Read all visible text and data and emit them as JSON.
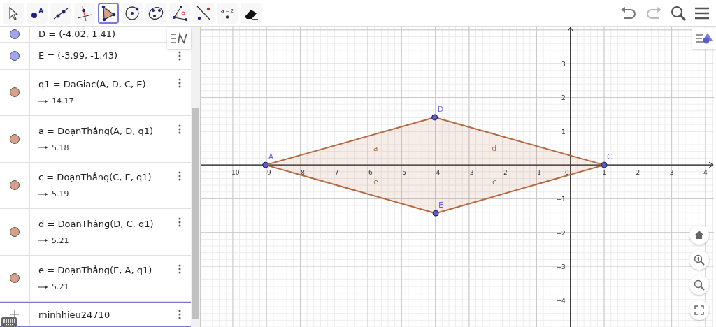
{
  "toolbar": {
    "tools": [
      {
        "kind": "move",
        "selected": false
      },
      {
        "kind": "point",
        "label": "A",
        "selected": false
      },
      {
        "kind": "line",
        "selected": false
      },
      {
        "kind": "perpendicular",
        "selected": false
      },
      {
        "kind": "polygon",
        "selected": true
      },
      {
        "kind": "circle",
        "selected": false
      },
      {
        "kind": "conic",
        "selected": false
      },
      {
        "kind": "angle",
        "selected": false
      },
      {
        "kind": "reflect",
        "selected": false
      },
      {
        "kind": "slider",
        "label": "a = 2",
        "selected": false
      },
      {
        "kind": "eraser",
        "selected": false
      }
    ]
  },
  "algebra": {
    "items": [
      {
        "text": "D = (-4.02, 1.41)",
        "color": "#a3a3f5"
      },
      {
        "text": "E = (-3.99, -1.43)",
        "color": "#a3a3f5"
      },
      {
        "text": "q1 = DaGiac(A, D, C, E)",
        "result": "14.17",
        "color": "#d9a088"
      },
      {
        "text": "a = ĐoạnThẳng(A, D, q1)",
        "result": "5.18",
        "color": "#d9a088"
      },
      {
        "text": "c = ĐoạnThẳng(C, E, q1)",
        "result": "5.19",
        "color": "#d9a088"
      },
      {
        "text": "d = ĐoạnThẳng(D, C, q1)",
        "result": "5.21",
        "color": "#d9a088"
      },
      {
        "text": "e = ĐoạnThẳng(E, A, q1)",
        "result": "5.21",
        "color": "#d9a088"
      }
    ],
    "input": {
      "value": "minhhieu24710"
    }
  },
  "graphics": {
    "chart_data": {
      "type": "area",
      "grid": true,
      "x": [
        -9.03,
        -4.02,
        1,
        -3.99,
        -9.03
      ],
      "series": [
        {
          "color": "#b5673e",
          "values": [
            0,
            1.41,
            0,
            -1.43,
            0
          ]
        }
      ],
      "xlim": [
        -10.95,
        4.25
      ],
      "ylim": [
        -4.8,
        4.1
      ],
      "xticks": [
        {
          "value": -10,
          "label": "−10"
        },
        {
          "value": -9,
          "label": "−9"
        },
        {
          "value": -8,
          "label": "−8"
        },
        {
          "value": -7,
          "label": "−7"
        },
        {
          "value": -6,
          "label": "−6"
        },
        {
          "value": -5,
          "label": "−5"
        },
        {
          "value": -4,
          "label": "−4"
        },
        {
          "value": -3,
          "label": "−3"
        },
        {
          "value": -2,
          "label": "−2"
        },
        {
          "value": -1,
          "label": "−1"
        },
        {
          "value": 0,
          "label": "0"
        },
        {
          "value": 1,
          "label": "1"
        },
        {
          "value": 2,
          "label": "2"
        },
        {
          "value": 3,
          "label": "3"
        },
        {
          "value": 4,
          "label": "4"
        }
      ],
      "yticks": [
        {
          "value": 3,
          "label": "3"
        },
        {
          "value": 2,
          "label": "2"
        },
        {
          "value": 1,
          "label": "1"
        },
        {
          "value": -1,
          "label": "−1"
        },
        {
          "value": -2,
          "label": "−2"
        },
        {
          "value": -3,
          "label": "−3"
        },
        {
          "value": -4,
          "label": "−4"
        }
      ]
    },
    "point_labels": [
      "A",
      "D",
      "C",
      "E"
    ],
    "segment_labels": [
      {
        "text": "a",
        "kind": "northwest"
      },
      {
        "text": "d",
        "kind": "northeast"
      },
      {
        "text": "e",
        "kind": "southwest"
      },
      {
        "text": "c",
        "kind": "southeast"
      }
    ]
  }
}
